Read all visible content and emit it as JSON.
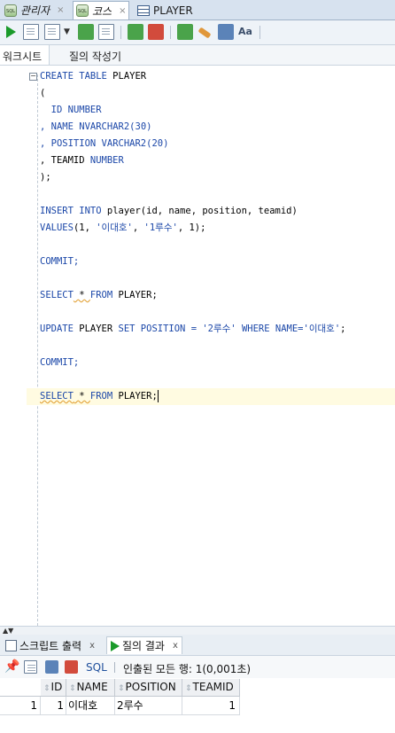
{
  "tabs": [
    {
      "label": "관리자",
      "close": "×",
      "icon": "sql-worksheet-icon"
    },
    {
      "label": "코스",
      "close": "×",
      "icon": "sql-worksheet-icon"
    },
    {
      "label": "PLAYER",
      "close": "",
      "icon": "table-icon"
    }
  ],
  "subtabs": {
    "worksheet": "워크시트",
    "query_builder": "질의 작성기"
  },
  "code": {
    "l1_kw1": "CREATE TABLE",
    "l1_rest": " PLAYER",
    "l2": "(",
    "l3_name": "  ID",
    "l3_type": " NUMBER",
    "l4_pre": ", NAME ",
    "l4_type": "NVARCHAR2",
    "l4_num": "(30)",
    "l5_pre": ", POSITION ",
    "l5_type": "VARCHAR2",
    "l5_num": "(20)",
    "l6_pre": ", TEAMID",
    "l6_type": " NUMBER",
    "l7": ");",
    "l9_kw": "INSERT INTO",
    "l9_rest": " player(id, name, position, teamid)",
    "l10_kw": "VALUES",
    "l10_a": "(1, ",
    "l10_s1": "'이대호'",
    "l10_b": ", ",
    "l10_s2": "'1루수'",
    "l10_c": ", 1);",
    "l12": "COMMIT;",
    "l14_kw": "SELECT",
    "l14_star": " * ",
    "l14_from": "FROM",
    "l14_rest": " PLAYER;",
    "l16_kw": "UPDATE",
    "l16_a": " PLAYER ",
    "l16_set": "SET",
    "l16_b": " POSITION = ",
    "l16_s1": "'2루수'",
    "l16_where": " WHERE",
    "l16_c": " NAME=",
    "l16_s2": "'이대호'",
    "l16_d": ";",
    "l18": "COMMIT;",
    "l20_kw": "SELECT",
    "l20_star": " * ",
    "l20_from": "FROM",
    "l20_rest": " PLAYER;"
  },
  "bottom_tabs": [
    {
      "label": "스크립트 출력",
      "close": "x"
    },
    {
      "label": "질의 결과",
      "close": "x"
    }
  ],
  "result_toolbar": {
    "sql_label": "SQL",
    "status": "인출된 모든 행: 1(0,001초)"
  },
  "grid": {
    "columns": [
      "ID",
      "NAME",
      "POSITION",
      "TEAMID"
    ],
    "rows": [
      {
        "rownum": "1",
        "ID": "1",
        "NAME": "이대호",
        "POSITION": "2루수",
        "TEAMID": "1"
      }
    ]
  },
  "colors": {
    "keyword": "#1b47a8",
    "current_line": "#fffbe1"
  }
}
